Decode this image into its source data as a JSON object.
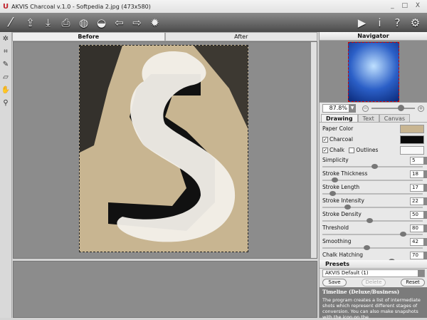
{
  "window": {
    "title": "AKVIS Charcoal v.1.0 - Softpedia 2.jpg (473x580)",
    "controls": "_ □ X"
  },
  "toolbar": {
    "left_icons": [
      "brush-logo-icon",
      "open-icon",
      "save-icon",
      "print-icon",
      "share-icon",
      "eraser-icon",
      "undo-icon",
      "redo-icon",
      "batch-gear-icon"
    ],
    "right_icons": [
      "run-icon",
      "info-icon",
      "help-icon",
      "settings-icon"
    ]
  },
  "left_tools": [
    "preset-tool-icon",
    "crop-icon",
    "pencil-icon",
    "eraser-icon",
    "hand-icon",
    "zoom-icon"
  ],
  "view_tabs": [
    {
      "label": "Before",
      "active": true
    },
    {
      "label": "After",
      "active": false
    }
  ],
  "navigator": {
    "title": "Navigator",
    "zoom": "87.8%",
    "zoom_slider": 0.6
  },
  "settings_tabs": [
    {
      "label": "Drawing",
      "active": true
    },
    {
      "label": "Text"
    },
    {
      "label": "Canvas"
    }
  ],
  "drawing": {
    "paper_color_label": "Paper Color",
    "paper_color": "#c8b591",
    "charcoal_label": "Charcoal",
    "charcoal_checked": true,
    "charcoal_color": "#0a0a0a",
    "chalk_label": "Chalk",
    "chalk_checked": true,
    "chalk_color": "#f8f8f8",
    "outlines_label": "Outlines",
    "outlines_checked": false,
    "params": [
      {
        "label": "Simplicity",
        "value": "5",
        "slider": 0.52
      },
      {
        "label": "Stroke Thickness",
        "value": "18",
        "slider": 0.12
      },
      {
        "label": "Stroke Length",
        "value": "17",
        "slider": 0.1
      },
      {
        "label": "Stroke Intensity",
        "value": "22",
        "slider": 0.25
      },
      {
        "label": "Stroke Density",
        "value": "50",
        "slider": 0.47
      },
      {
        "label": "Threshold",
        "value": "80",
        "slider": 0.8
      },
      {
        "label": "Smoothing",
        "value": "42",
        "slider": 0.44
      },
      {
        "label": "Chalk Hatching",
        "value": "70",
        "slider": 0.69
      }
    ]
  },
  "presets": {
    "title": "Presets",
    "selected": "AKVIS Default (1)",
    "save": "Save",
    "delete": "Delete",
    "reset": "Reset"
  },
  "timeline": {
    "title": "Timeline (Deluxe/Business)",
    "text": "The program creates a list of intermediate shots which represent different stages of conversion. You can also make snapshots with the icon on the"
  }
}
